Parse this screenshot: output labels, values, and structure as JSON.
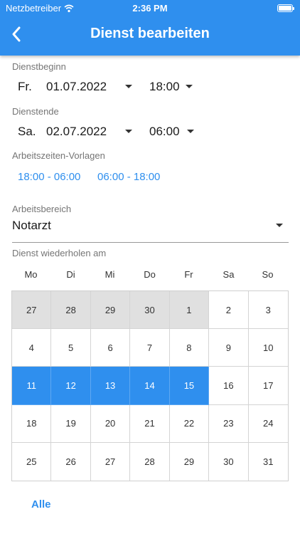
{
  "status": {
    "carrier": "Netzbetreiber",
    "time": "2:36 PM"
  },
  "header": {
    "title": "Dienst bearbeiten"
  },
  "start": {
    "label": "Dienstbeginn",
    "weekday": "Fr.",
    "date": "01.07.2022",
    "time": "18:00"
  },
  "end": {
    "label": "Dienstende",
    "weekday": "Sa.",
    "date": "02.07.2022",
    "time": "06:00"
  },
  "templates": {
    "label": "Arbeitszeiten-Vorlagen",
    "items": [
      "18:00 - 06:00",
      "06:00 - 18:00"
    ]
  },
  "area": {
    "label": "Arbeitsbereich",
    "value": "Notarzt"
  },
  "repeat": {
    "label": "Dienst wiederholen am",
    "weekdays": [
      "Mo",
      "Di",
      "Mi",
      "Do",
      "Fr",
      "Sa",
      "So"
    ],
    "days": [
      {
        "d": "27",
        "s": "outside"
      },
      {
        "d": "28",
        "s": "outside"
      },
      {
        "d": "29",
        "s": "outside"
      },
      {
        "d": "30",
        "s": "outside"
      },
      {
        "d": "1",
        "s": "outside"
      },
      {
        "d": "2",
        "s": ""
      },
      {
        "d": "3",
        "s": ""
      },
      {
        "d": "4",
        "s": ""
      },
      {
        "d": "5",
        "s": ""
      },
      {
        "d": "6",
        "s": ""
      },
      {
        "d": "7",
        "s": ""
      },
      {
        "d": "8",
        "s": ""
      },
      {
        "d": "9",
        "s": ""
      },
      {
        "d": "10",
        "s": ""
      },
      {
        "d": "11",
        "s": "selected"
      },
      {
        "d": "12",
        "s": "selected"
      },
      {
        "d": "13",
        "s": "selected"
      },
      {
        "d": "14",
        "s": "selected"
      },
      {
        "d": "15",
        "s": "selected"
      },
      {
        "d": "16",
        "s": ""
      },
      {
        "d": "17",
        "s": ""
      },
      {
        "d": "18",
        "s": ""
      },
      {
        "d": "19",
        "s": ""
      },
      {
        "d": "20",
        "s": ""
      },
      {
        "d": "21",
        "s": ""
      },
      {
        "d": "22",
        "s": ""
      },
      {
        "d": "23",
        "s": ""
      },
      {
        "d": "24",
        "s": ""
      },
      {
        "d": "25",
        "s": ""
      },
      {
        "d": "26",
        "s": ""
      },
      {
        "d": "27",
        "s": ""
      },
      {
        "d": "28",
        "s": ""
      },
      {
        "d": "29",
        "s": ""
      },
      {
        "d": "30",
        "s": ""
      },
      {
        "d": "31",
        "s": ""
      }
    ],
    "all_label": "Alle"
  },
  "colors": {
    "accent": "#2f8fee",
    "outside": "#e0e0e0"
  }
}
